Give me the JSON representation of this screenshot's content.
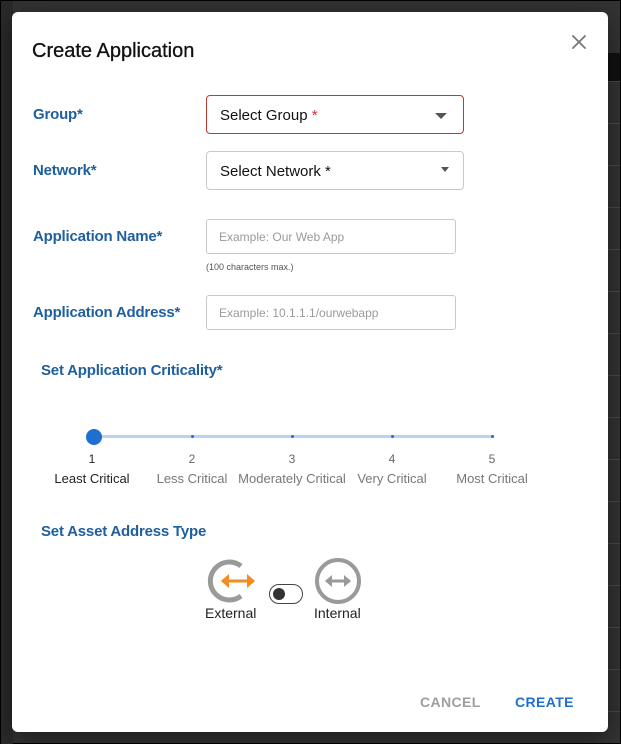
{
  "dialog": {
    "title": "Create Application",
    "close_icon": "close-icon"
  },
  "form": {
    "group": {
      "label": "Group*",
      "value": "Select Group",
      "required_mark": "*"
    },
    "network": {
      "label": "Network*",
      "value": "Select Network *"
    },
    "app_name": {
      "label": "Application Name*",
      "placeholder": "Example: Our Web App",
      "value": "",
      "hint": "(100 characters max.)"
    },
    "app_address": {
      "label": "Application Address*",
      "placeholder": "Example: 10.1.1.1/ourwebapp",
      "value": ""
    }
  },
  "criticality": {
    "label": "Set Application Criticality*",
    "selected": 1,
    "marks": [
      {
        "num": "1",
        "label": "Least Critical"
      },
      {
        "num": "2",
        "label": "Less Critical"
      },
      {
        "num": "3",
        "label": "Moderately Critical"
      },
      {
        "num": "4",
        "label": "Very Critical"
      },
      {
        "num": "5",
        "label": "Most Critical"
      }
    ]
  },
  "address_type": {
    "label": "Set Asset Address Type",
    "external_label": "External",
    "internal_label": "Internal",
    "toggle_on": false,
    "external_icon": "external-arrows-icon",
    "internal_icon": "internal-arrows-icon"
  },
  "actions": {
    "cancel_label": "CANCEL",
    "create_label": "CREATE"
  },
  "colors": {
    "accent": "#1e6fd0",
    "label": "#1f5f9c",
    "error": "#d32f2f",
    "external_arrow": "#f28c1e"
  }
}
